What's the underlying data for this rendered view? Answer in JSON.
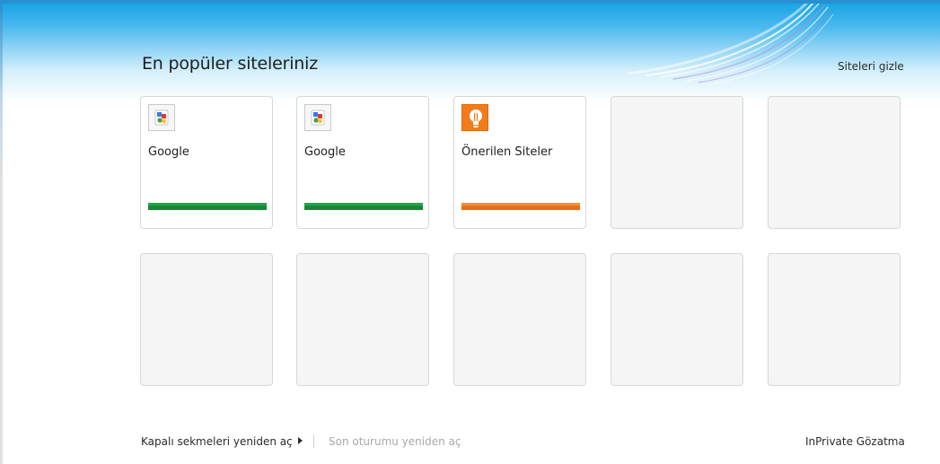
{
  "header": {
    "title": "En popüler siteleriniz",
    "hide_link": "Siteleri gizle"
  },
  "tiles": [
    {
      "label": "Google",
      "icon": "google-favicon-icon",
      "bar_color": "#1f9a45"
    },
    {
      "label": "Google",
      "icon": "google-favicon-icon",
      "bar_color": "#1f9a45"
    },
    {
      "label": "Önerilen Siteler",
      "icon": "lightbulb-icon",
      "bar_color": "#f47a1a"
    },
    {
      "label": ""
    },
    {
      "label": ""
    },
    {
      "label": ""
    },
    {
      "label": ""
    },
    {
      "label": ""
    },
    {
      "label": ""
    },
    {
      "label": ""
    }
  ],
  "footer": {
    "reopen_closed_tabs": "Kapalı sekmeleri yeniden aç",
    "reopen_last_session": "Son oturumu yeniden aç",
    "inprivate": "InPrivate Gözatma"
  },
  "colors": {
    "banner_blue": "#19a5e6",
    "activity_green": "#1f9a45",
    "activity_orange": "#f47a1a",
    "disabled_text": "#a8a8a8"
  }
}
